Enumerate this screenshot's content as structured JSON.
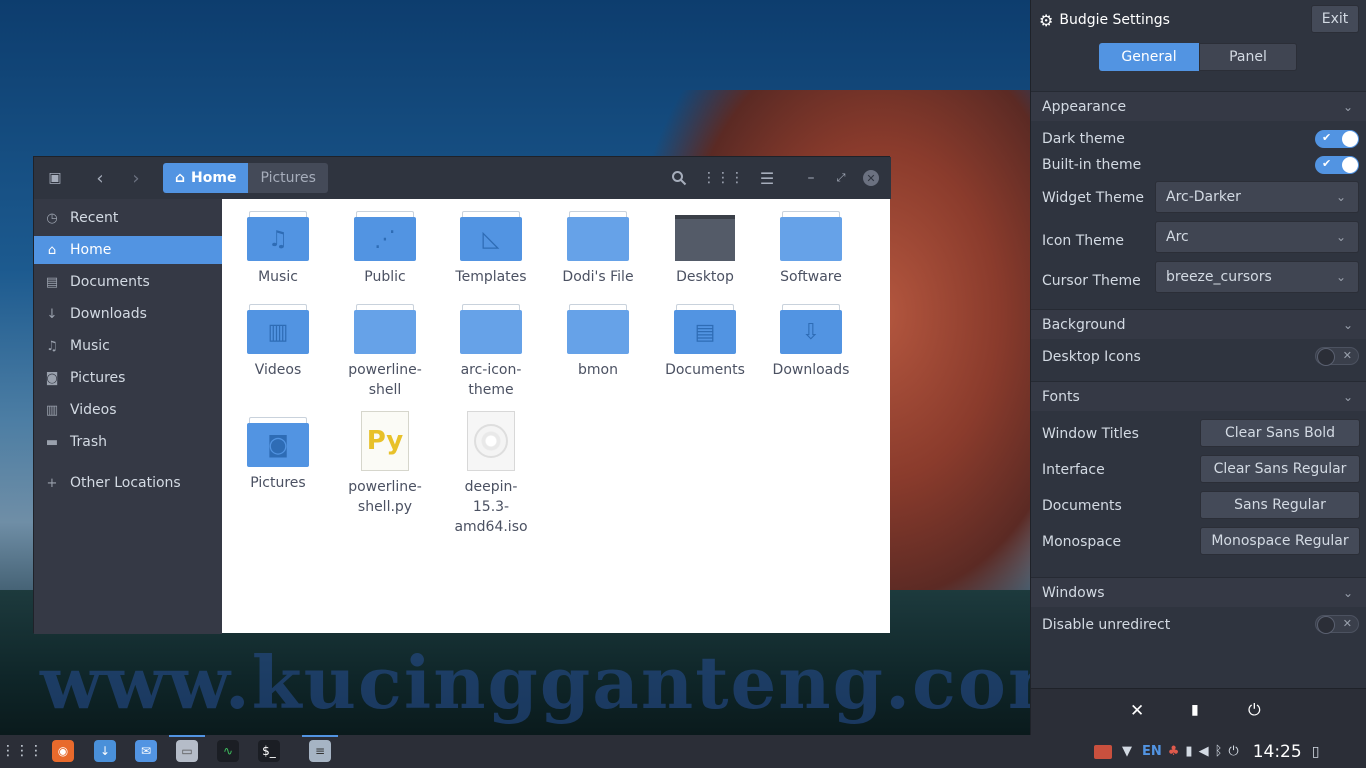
{
  "desktop": {
    "watermark": "www.kucingganteng.com"
  },
  "file_manager": {
    "breadcrumbs": [
      "Home",
      "Pictures"
    ],
    "sidebar": [
      {
        "label": "Recent",
        "icon": "clock-icon",
        "glyph": "◷"
      },
      {
        "label": "Home",
        "icon": "home-icon",
        "glyph": "⌂"
      },
      {
        "label": "Documents",
        "icon": "document-icon",
        "glyph": "▤"
      },
      {
        "label": "Downloads",
        "icon": "download-icon",
        "glyph": "↓"
      },
      {
        "label": "Music",
        "icon": "music-icon",
        "glyph": "♫"
      },
      {
        "label": "Pictures",
        "icon": "camera-icon",
        "glyph": "◙"
      },
      {
        "label": "Videos",
        "icon": "film-icon",
        "glyph": "▥"
      },
      {
        "label": "Trash",
        "icon": "trash-icon",
        "glyph": "▬"
      },
      {
        "label": "Other Locations",
        "icon": "plus-icon",
        "glyph": "+"
      }
    ],
    "items": [
      {
        "name": "Music",
        "kind": "folder",
        "glyph": "♫"
      },
      {
        "name": "Public",
        "kind": "folder",
        "glyph": "⋰"
      },
      {
        "name": "Templates",
        "kind": "folder",
        "glyph": "◺"
      },
      {
        "name": "Dodi's File",
        "kind": "folder",
        "glyph": ""
      },
      {
        "name": "Desktop",
        "kind": "desktop",
        "glyph": ""
      },
      {
        "name": "Software",
        "kind": "folder",
        "glyph": ""
      },
      {
        "name": "Videos",
        "kind": "folder",
        "glyph": "▥"
      },
      {
        "name": "powerline-shell",
        "kind": "folder",
        "glyph": ""
      },
      {
        "name": "arc-icon-theme",
        "kind": "folder",
        "glyph": ""
      },
      {
        "name": "bmon",
        "kind": "folder",
        "glyph": ""
      },
      {
        "name": "Documents",
        "kind": "folder",
        "glyph": "▤"
      },
      {
        "name": "Downloads",
        "kind": "folder",
        "glyph": "⇩"
      },
      {
        "name": "Pictures",
        "kind": "folder",
        "glyph": "◙"
      },
      {
        "name": "powerline-shell.py",
        "kind": "python",
        "glyph": "Py"
      },
      {
        "name": "deepin-15.3-amd64.iso",
        "kind": "iso",
        "glyph": ""
      }
    ]
  },
  "budgie": {
    "title": "Budgie Settings",
    "exit_label": "Exit",
    "tabs": [
      "General",
      "Panel"
    ],
    "appearance": {
      "header": "Appearance",
      "dark_theme_label": "Dark theme",
      "dark_theme_on": true,
      "builtin_theme_label": "Built-in theme",
      "builtin_theme_on": true,
      "widget_theme_label": "Widget Theme",
      "widget_theme_value": "Arc-Darker",
      "icon_theme_label": "Icon Theme",
      "icon_theme_value": "Arc",
      "cursor_theme_label": "Cursor Theme",
      "cursor_theme_value": "breeze_cursors"
    },
    "background": {
      "header": "Background",
      "desktop_icons_label": "Desktop Icons",
      "desktop_icons_on": false
    },
    "fonts": {
      "header": "Fonts",
      "rows": [
        {
          "label": "Window Titles",
          "value": "Clear Sans Bold"
        },
        {
          "label": "Interface",
          "value": "Clear Sans Regular"
        },
        {
          "label": "Documents",
          "value": "Sans Regular"
        },
        {
          "label": "Monospace",
          "value": "Monospace Regular"
        }
      ]
    },
    "windows": {
      "header": "Windows",
      "unredirect_label": "Disable unredirect",
      "unredirect_on": false
    }
  },
  "taskbar": {
    "keyboard_layout": "EN",
    "clock": "14:25"
  },
  "colors": {
    "accent": "#5294e2",
    "panel_bg": "#2f343f",
    "sidebar_bg": "#353945"
  }
}
